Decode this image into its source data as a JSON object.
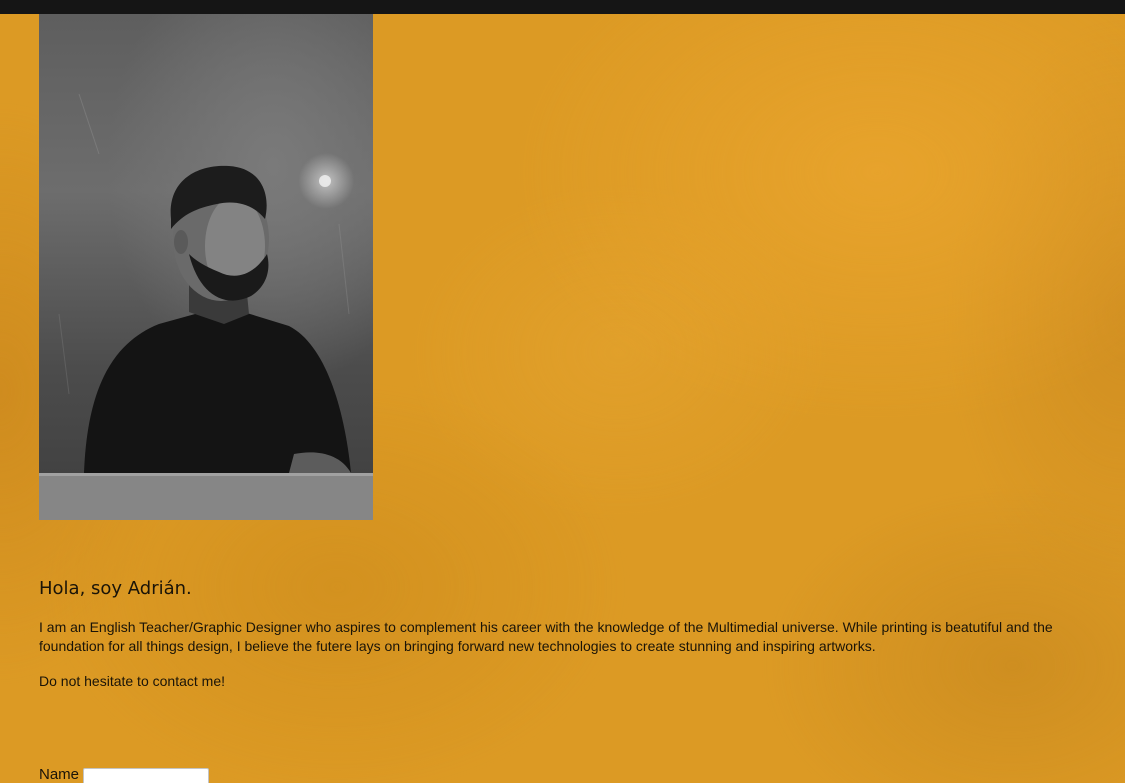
{
  "profile": {
    "photo_alt": "Black and white portrait of a bearded man"
  },
  "intro": {
    "heading": "Hola, soy Adrián.",
    "bio": "I am an English Teacher/Graphic Designer who aspires to complement his career with the knowledge of the Multimedial universe. While printing is beatutiful and the foundation for all things design, I believe the futere lays on bringing forward new technologies to create stunning and inspiring artworks.",
    "cta": "Do not hesitate to contact me!"
  },
  "contact_form": {
    "name_label": "Name",
    "name_value": "",
    "name_placeholder": ""
  },
  "colors": {
    "background": "#dc9a24",
    "top_bar": "#151515",
    "text": "#1a1408"
  }
}
